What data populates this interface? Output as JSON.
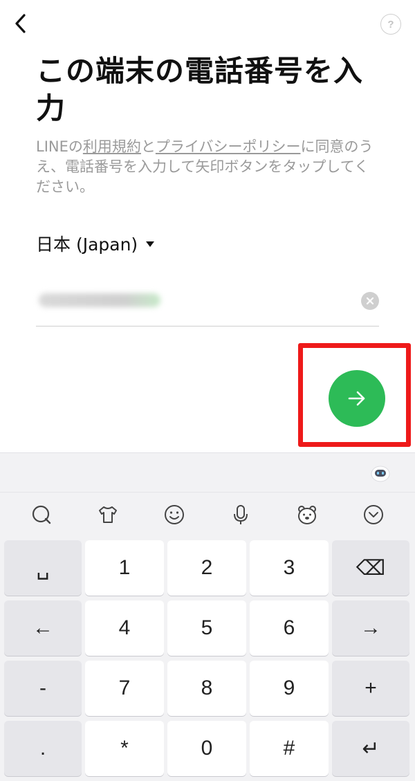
{
  "header": {
    "back_icon": "chevron-left-icon",
    "help_label": "?"
  },
  "title": "この端末の電話番号を入力",
  "description": {
    "prefix": "LINEの",
    "terms_link": "利用規約",
    "and": "と",
    "privacy_link": "プライバシーポリシー",
    "suffix": "に同意のうえ、電話番号を入力して矢印ボタンをタップしてください。"
  },
  "country": {
    "label": "日本 (Japan)"
  },
  "phone": {
    "value_hidden": true
  },
  "next_button": {
    "icon": "arrow-right-icon",
    "color": "#2dbb57"
  },
  "highlight_color": "#ee1a1a",
  "keyboard": {
    "tools": [
      "search-icon",
      "shirt-icon",
      "emoji-icon",
      "mic-icon",
      "bear-sticker-icon",
      "collapse-icon"
    ],
    "keys": [
      {
        "label": "␣",
        "fn": true,
        "name": "space"
      },
      {
        "label": "1",
        "fn": false,
        "name": "1"
      },
      {
        "label": "2",
        "fn": false,
        "name": "2"
      },
      {
        "label": "3",
        "fn": false,
        "name": "3"
      },
      {
        "label": "⌫",
        "fn": true,
        "name": "backspace"
      },
      {
        "label": "←",
        "fn": true,
        "name": "left"
      },
      {
        "label": "4",
        "fn": false,
        "name": "4"
      },
      {
        "label": "5",
        "fn": false,
        "name": "5"
      },
      {
        "label": "6",
        "fn": false,
        "name": "6"
      },
      {
        "label": "→",
        "fn": true,
        "name": "right"
      },
      {
        "label": "-",
        "fn": true,
        "name": "minus"
      },
      {
        "label": "7",
        "fn": false,
        "name": "7"
      },
      {
        "label": "8",
        "fn": false,
        "name": "8"
      },
      {
        "label": "9",
        "fn": false,
        "name": "9"
      },
      {
        "label": "+",
        "fn": true,
        "name": "plus"
      },
      {
        "label": ".",
        "fn": true,
        "name": "period"
      },
      {
        "label": "*",
        "fn": false,
        "name": "asterisk"
      },
      {
        "label": "0",
        "fn": false,
        "name": "0"
      },
      {
        "label": "#",
        "fn": false,
        "name": "hash"
      },
      {
        "label": "↵",
        "fn": true,
        "name": "enter"
      }
    ]
  }
}
